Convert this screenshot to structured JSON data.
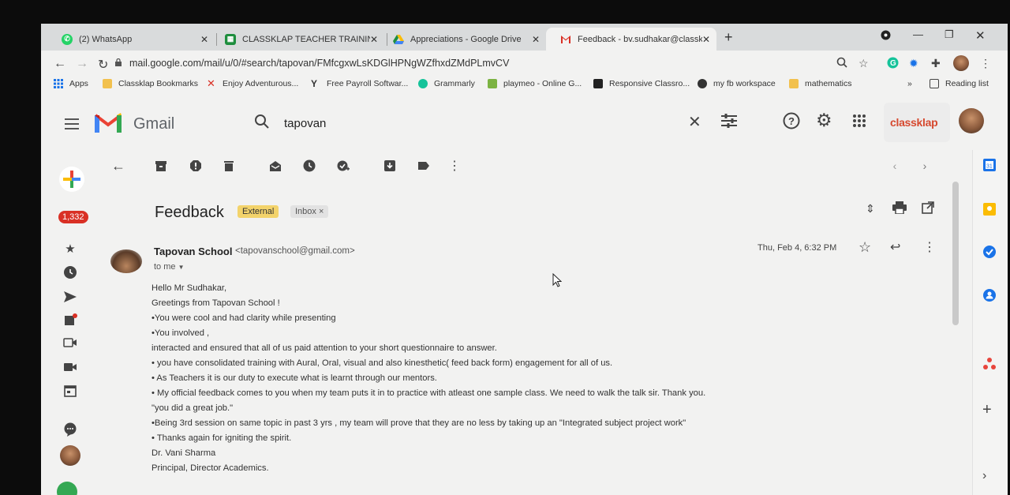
{
  "browser": {
    "tabs": [
      {
        "label": "(2) WhatsApp",
        "icon": "whatsapp-icon",
        "color": "#25d366"
      },
      {
        "label": "CLASSKLAP TEACHER TRAINING",
        "icon": "sheets-icon",
        "color": "#1e8e3e"
      },
      {
        "label": "Appreciations - Google Drive",
        "icon": "drive-icon",
        "color": "#fbbc04"
      },
      {
        "label": "Feedback - bv.sudhakar@classkl",
        "icon": "gmail-icon",
        "color": "#d93025"
      }
    ],
    "url": "mail.google.com/mail/u/0/#search/tapovan/FMfcgxwLsKDGlHPNgWZfhxdZMdPLmvCV"
  },
  "bookmarks": [
    {
      "label": "Apps",
      "icon": "apps-grid-icon"
    },
    {
      "label": "Classklap Bookmarks",
      "icon": "folder-icon"
    },
    {
      "label": "Enjoy Adventurous...",
      "icon": "bookmark-x-icon"
    },
    {
      "label": "Free Payroll Softwar...",
      "icon": "y-logo-icon"
    },
    {
      "label": "Grammarly",
      "icon": "grammarly-icon"
    },
    {
      "label": "playmeo - Online G...",
      "icon": "playmeo-icon"
    },
    {
      "label": "Responsive Classro...",
      "icon": "responsive-icon"
    },
    {
      "label": "my fb workspace",
      "icon": "workplace-icon"
    },
    {
      "label": "mathematics",
      "icon": "folder-icon"
    }
  ],
  "reading_list": "Reading list",
  "more_bookmarks": "»",
  "gmail": {
    "brand": "Gmail",
    "search_value": "tapovan",
    "account_logo": "classklap",
    "unread_count": "1,332"
  },
  "email": {
    "subject": "Feedback",
    "labels": [
      "External",
      "Inbox ×"
    ],
    "sender_name": "Tapovan School",
    "sender_email": "<tapovanschool@gmail.com>",
    "recipient": "to me",
    "date": "Thu, Feb 4, 6:32 PM",
    "body": [
      "Hello Mr Sudhakar,",
      "Greetings from Tapovan School !",
      "•You were cool and had clarity while presenting",
      "•You involved ,",
      "interacted and ensured that  all of us paid attention to your  short questionnaire  to answer.",
      "• you have consolidated training with Aural, Oral, visual and also kinesthetic( feed back form) engagement for all of us.",
      "• As Teachers it is our duty to execute what is learnt through  our mentors.",
      "• My official feedback comes to you when my team puts it  in to practice with atleast one sample class. We need to walk the talk sir. Thank you.",
      "\"you did a great job.\"",
      "•Being 3rd session on same topic in past  3 yrs , my team will prove that they are no less by taking up an \"Integrated subject project work\"",
      "• Thanks again for igniting the spirit.",
      "Dr. Vani Sharma",
      "Principal, Director Academics."
    ]
  }
}
